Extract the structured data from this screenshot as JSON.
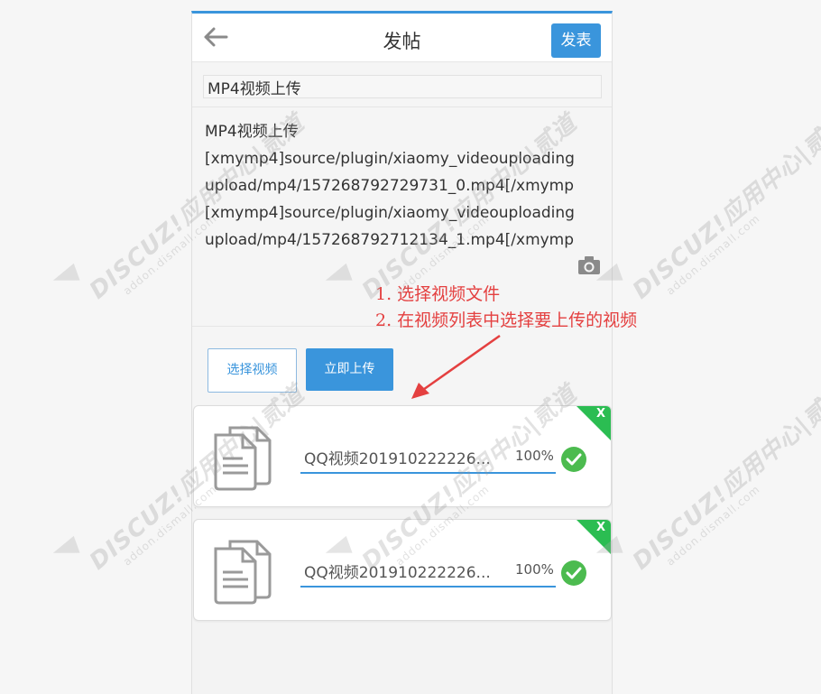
{
  "header": {
    "title": "发帖",
    "publish_label": "发表"
  },
  "form": {
    "title_value": "MP4视频上传",
    "content_lines": [
      "MP4视频上传",
      "[xmymp4]source/plugin/xiaomy_videouploading",
      "upload/mp4/157268792729731_0.mp4[/xmymp",
      "[xmymp4]source/plugin/xiaomy_videouploading",
      "upload/mp4/157268792712134_1.mp4[/xmymp"
    ]
  },
  "buttons": {
    "select_video": "选择视频",
    "upload_now": "立即上传"
  },
  "files": [
    {
      "name": "QQ视频201910222226...",
      "percent": "100%",
      "progress": 1.0,
      "close": "X"
    },
    {
      "name": "QQ视频201910222226...",
      "percent": "100%",
      "progress": 1.0,
      "close": "X"
    }
  ],
  "annotation": {
    "line1": "1. 选择视频文件",
    "line2": "2. 在视频列表中选择要上传的视频"
  },
  "watermark": {
    "main": "DISCUZ!应用中心|贰道",
    "sub": "addon.dismall.com"
  },
  "colors": {
    "accent": "#3a95dc",
    "success": "#4cbb4f",
    "corner": "#2bbd52",
    "annotation": "#e44040"
  }
}
